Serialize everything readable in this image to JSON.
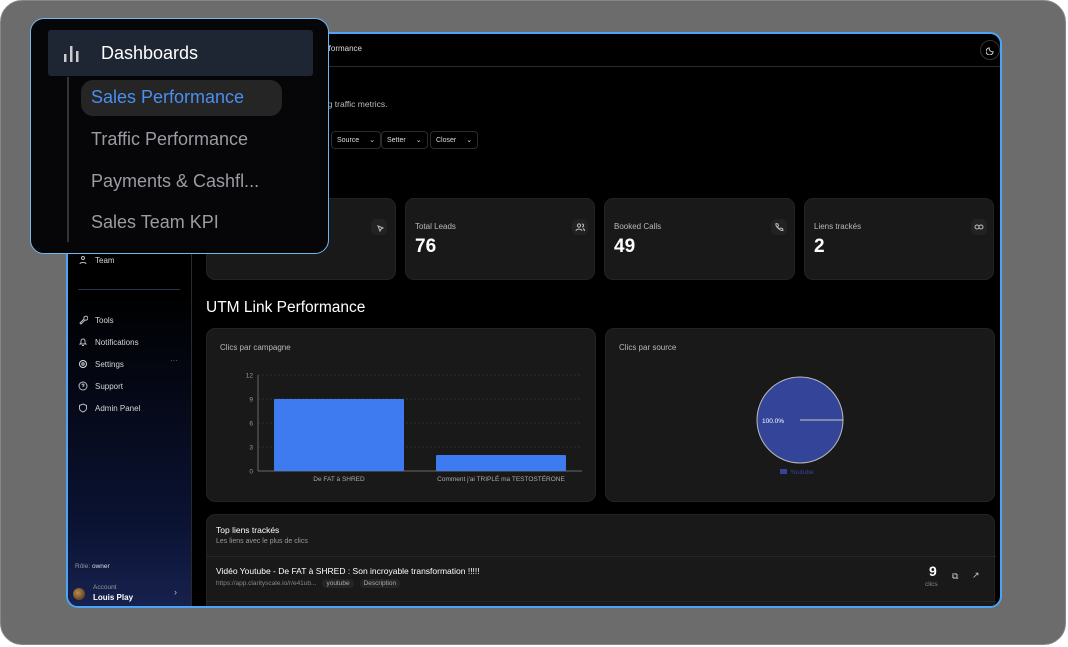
{
  "header": {
    "breadcrumb_fragment": "formance",
    "theme_icon": "moon-icon"
  },
  "page": {
    "subtitle_fragment": "eting traffic metrics.",
    "filters": [
      "Source",
      "Setter",
      "Closer"
    ]
  },
  "sidebar": {
    "items": [
      {
        "label": "Team",
        "icon": "team-icon"
      },
      {
        "label": "Tools",
        "icon": "wrench-icon"
      },
      {
        "label": "Notifications",
        "icon": "bell-icon"
      },
      {
        "label": "Settings",
        "icon": "gear-icon"
      },
      {
        "label": "Support",
        "icon": "help-icon"
      },
      {
        "label": "Admin Panel",
        "icon": "shield-icon"
      }
    ],
    "role_label": "Rôle:",
    "role": "owner",
    "account_label": "Account",
    "account_name": "Louis Play"
  },
  "stats": [
    {
      "label": "Total Leads",
      "value": "76",
      "icon": "users-icon"
    },
    {
      "label": "Booked Calls",
      "value": "49",
      "icon": "phone-icon"
    },
    {
      "label": "Liens trackés",
      "value": "2",
      "icon": "link-icon"
    }
  ],
  "section_title": "UTM Link Performance",
  "chart_data": [
    {
      "type": "bar",
      "title": "Clics par campagne",
      "categories": [
        "De FAT à SHRED",
        "Comment j'ai TRIPLÉ ma TESTOSTÉRONE"
      ],
      "values": [
        9,
        2
      ],
      "ylim": [
        0,
        12
      ],
      "yticks": [
        "0",
        "3",
        "6",
        "9",
        "12"
      ],
      "color": "#3f7bf0"
    },
    {
      "type": "pie",
      "title": "Clics par source",
      "labels": [
        "Youtube"
      ],
      "values": [
        100
      ],
      "slice_label": "100.0%",
      "color": "#334499"
    }
  ],
  "top_links": {
    "title": "Top liens trackés",
    "subtitle": "Les liens avec le plus de clics",
    "items": [
      {
        "title": "Vidéo Youtube - De FAT à SHRED : Son incroyable transformation !!!!!",
        "url": "https://app.clarityscale.io/r/e41ub...",
        "tags": [
          "youtube",
          "Description"
        ],
        "count": "9",
        "count_label": "clics"
      }
    ]
  },
  "popup": {
    "header": "Dashboards",
    "items": [
      "Sales Performance",
      "Traffic Performance",
      "Payments & Cashfl...",
      "Sales Team KPI"
    ],
    "active_color": "#4a8ef0"
  }
}
